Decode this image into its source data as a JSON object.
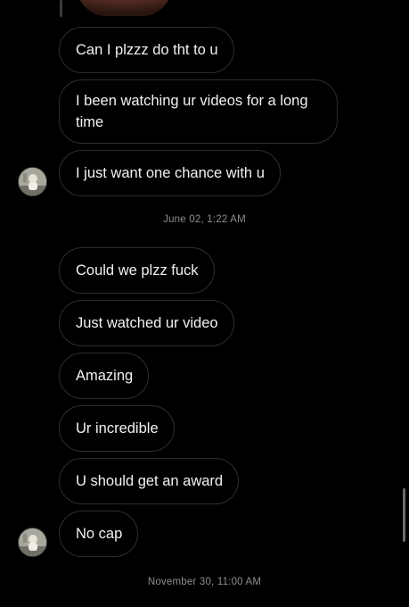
{
  "messages": [
    {
      "text": "Can I plzzz do tht to u"
    },
    {
      "text": "I been watching ur videos for a long time"
    },
    {
      "text": "I just want one chance with u"
    },
    {
      "text": "Could we plzz fuck"
    },
    {
      "text": "Just watched ur video"
    },
    {
      "text": "Amazing"
    },
    {
      "text": "Ur incredible"
    },
    {
      "text": "U should get an award"
    },
    {
      "text": "No cap"
    }
  ],
  "timestamps": [
    {
      "text": "June 02, 1:22 AM"
    },
    {
      "text": "November 30, 11:00 AM"
    }
  ],
  "colors": {
    "background": "#000000",
    "bubble_border": "#2e2e2e",
    "message_text": "#f2f2f2",
    "timestamp_text": "#8e8e8e"
  },
  "icons": {
    "avatar": "avatar-photo",
    "shared_media": "shared-photo-thumbnail"
  }
}
